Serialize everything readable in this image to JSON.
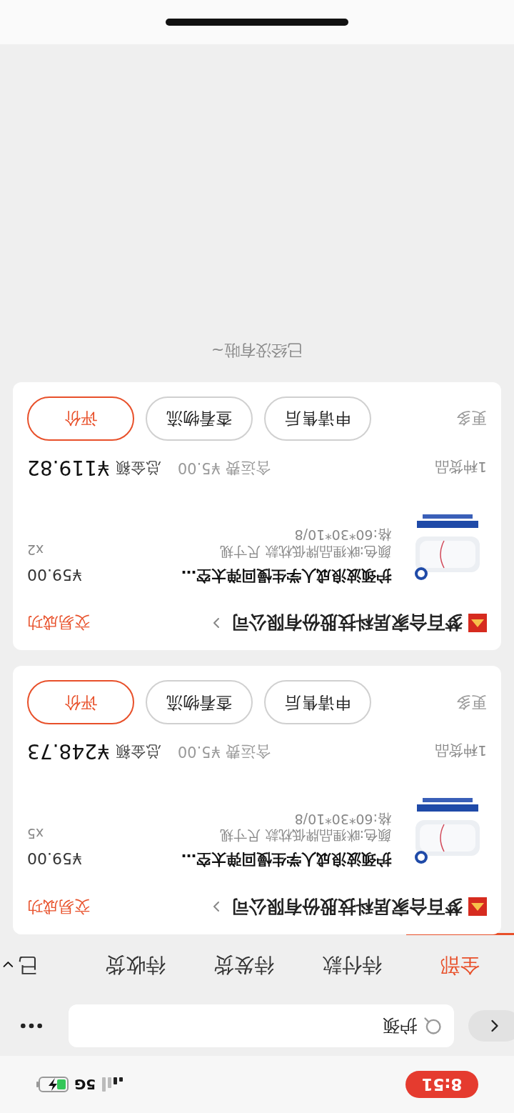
{
  "status_bar": {
    "time": "8:51",
    "network": "5G"
  },
  "search": {
    "value": "护颈"
  },
  "tabs": [
    {
      "label": "全部",
      "selected": true
    },
    {
      "label": "待付款",
      "selected": false
    },
    {
      "label": "待发货",
      "selected": false
    },
    {
      "label": "待收货",
      "selected": false
    },
    {
      "label": "已",
      "selected": false
    }
  ],
  "orders": [
    {
      "store": "梦百合家居科技股份有限公司",
      "status": "交易成功",
      "product": {
        "kind": "picture",
        "title": "护颈波浪成人学生慢回弹太空…",
        "price": "¥59.00",
        "spec": "颜色:眯狸品牌低枕款 尺寸规格:60*30*10/8",
        "quantity": "x5"
      },
      "goods_count": "1种货品",
      "shipping": "含运费 ¥5.00",
      "total_label": "总金额",
      "total": "¥248.73",
      "more": "更多",
      "buttons": [
        {
          "label": "申请售后",
          "primary": false
        },
        {
          "label": "查看物流",
          "primary": false
        },
        {
          "label": "评价",
          "primary": true
        }
      ]
    },
    {
      "store": "梦百合家居科技股份有限公司",
      "status": "交易成功",
      "product": {
        "kind": "picture",
        "title": "护颈波浪成人学生慢回弹太空…",
        "price": "¥59.00",
        "spec": "颜色:眯狸品牌低枕款 尺寸规格:60*30*10/8",
        "quantity": "x2"
      },
      "goods_count": "1种货品",
      "shipping": "含运费 ¥5.00",
      "total_label": "总金额",
      "total": "¥119.82",
      "more": "更多",
      "buttons": [
        {
          "label": "申请售后",
          "primary": false
        },
        {
          "label": "查看物流",
          "primary": false
        },
        {
          "label": "评价",
          "primary": true
        }
      ]
    }
  ],
  "end_note": "已经没有啦~"
}
